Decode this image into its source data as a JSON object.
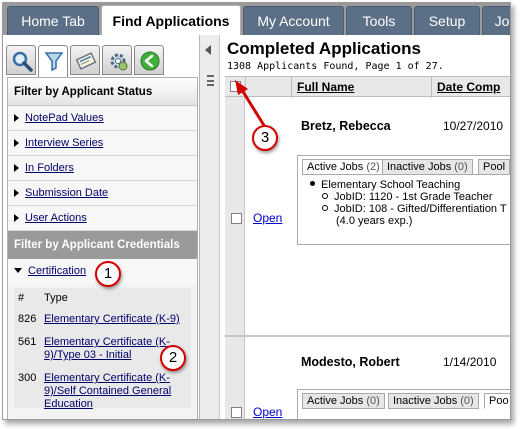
{
  "tabs": [
    {
      "label": "Home Tab"
    },
    {
      "label": "Find Applications"
    },
    {
      "label": "My Account"
    },
    {
      "label": "Tools"
    },
    {
      "label": "Setup"
    },
    {
      "label": "Jo"
    }
  ],
  "sidebar": {
    "icons": [
      "search-icon",
      "filter-icon",
      "card-icon",
      "gear-icon",
      "back-icon"
    ],
    "status_header": "Filter by Applicant Status",
    "status_items": [
      {
        "label": "NotePad Values"
      },
      {
        "label": "Interview Series"
      },
      {
        "label": "In Folders"
      },
      {
        "label": "Submission Date"
      },
      {
        "label": "User Actions"
      }
    ],
    "credentials_header": "Filter by Applicant Credentials",
    "certification_label": "Certification",
    "cert_table": {
      "col_num": "#",
      "col_type": "Type",
      "rows": [
        {
          "num": "826",
          "type": "Elementary Certificate (K-9)"
        },
        {
          "num": "561",
          "type": "Elementary Certificate (K-9)/Type 03 - Initial"
        },
        {
          "num": "300",
          "type": "Elementary Certificate (K-9)/Self Contained General Education"
        }
      ]
    }
  },
  "main": {
    "title": "Completed Applications",
    "subtitle": "1308 Applicants Found, Page 1 of 27.",
    "columns": {
      "full_name": "Full Name",
      "date": "Date Comp"
    },
    "applicants": [
      {
        "name": "Bretz,   Rebecca",
        "date": "10/27/2010",
        "open_label": "Open",
        "job_tabs": [
          {
            "label": "Active Jobs",
            "count": "(2)"
          },
          {
            "label": "Inactive Jobs",
            "count": "(0)"
          },
          {
            "label": "Pool",
            "count": ""
          }
        ],
        "job_group": "Elementary School Teaching",
        "jobs": [
          {
            "text": "JobID: 1120 - 1st Grade Teacher"
          },
          {
            "text": "JobID: 108 - Gifted/Differentiation T"
          }
        ],
        "experience": "(4.0 years exp.)"
      },
      {
        "name": "Modesto,   Robert",
        "date": "1/14/2010",
        "open_label": "Open",
        "job_tabs": [
          {
            "label": "Active Jobs",
            "count": "(0)"
          },
          {
            "label": "Inactive Jobs",
            "count": "(0)"
          },
          {
            "label": "Poo",
            "count": ""
          }
        ]
      }
    ]
  },
  "callouts": [
    "1",
    "2",
    "3"
  ],
  "colors": {
    "tab_bg": "#5b6f87",
    "header_dark": "#9a9a9a",
    "callout_border": "#d40000",
    "link": "#00006a"
  }
}
